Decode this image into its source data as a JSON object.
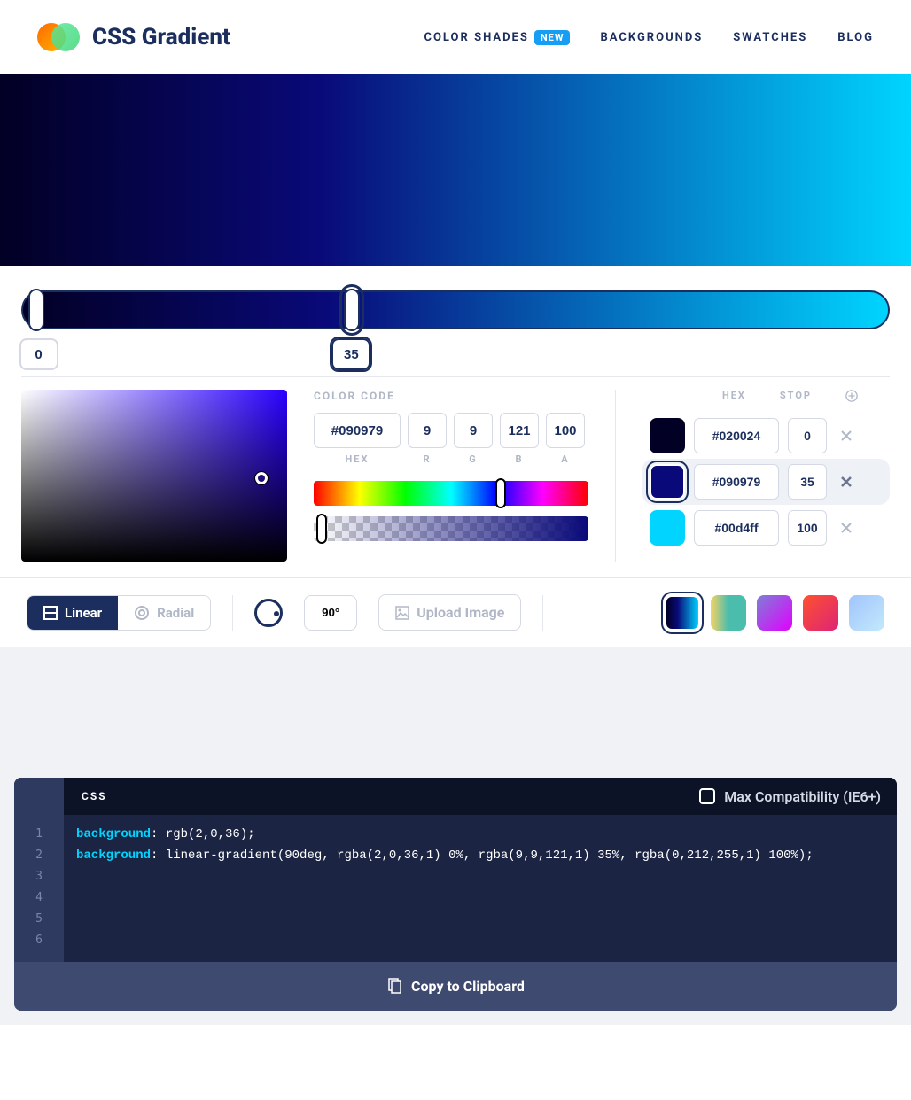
{
  "header": {
    "title": "CSS Gradient",
    "nav": {
      "shades": "COLOR SHADES",
      "shades_badge": "NEW",
      "backgrounds": "BACKGROUNDS",
      "swatches": "SWATCHES",
      "blog": "BLOG"
    }
  },
  "slider": {
    "pos0": "0",
    "pos1": "35"
  },
  "color_code": {
    "label": "COLOR CODE",
    "hex": "#090979",
    "r": "9",
    "g": "9",
    "b": "121",
    "a": "100",
    "sub_hex": "HEX",
    "sub_r": "R",
    "sub_g": "G",
    "sub_b": "B",
    "sub_a": "A"
  },
  "stops": {
    "head_hex": "HEX",
    "head_stop": "STOP",
    "rows": [
      {
        "color": "#020024",
        "hex": "#020024",
        "pos": "0"
      },
      {
        "color": "#090979",
        "hex": "#090979",
        "pos": "35"
      },
      {
        "color": "#00d4ff",
        "hex": "#00d4ff",
        "pos": "100"
      }
    ]
  },
  "controls": {
    "linear": "Linear",
    "radial": "Radial",
    "angle": "90°",
    "upload": "Upload Image"
  },
  "presets": [
    "linear-gradient(90deg,#020024,#090979 35%,#00d4ff)",
    "linear-gradient(90deg,#f6d365,#4abdac,#4abdac)",
    "linear-gradient(135deg,#7f7fd5,#e100ff)",
    "linear-gradient(135deg,#ff512f,#dd2476)",
    "linear-gradient(135deg,#a1c4fd,#c2e9fb)"
  ],
  "code": {
    "tab": "CSS",
    "compat": "Max Compatibility (IE6+)",
    "line1_prop": "background",
    "line1_val": ": rgb(2,0,36);",
    "line2_prop": "background",
    "line2_val": ": linear-gradient(90deg, rgba(2,0,36,1) 0%, rgba(9,9,121,1) 35%, rgba(0,212,255,1) 100%);",
    "copy": "Copy to Clipboard"
  }
}
